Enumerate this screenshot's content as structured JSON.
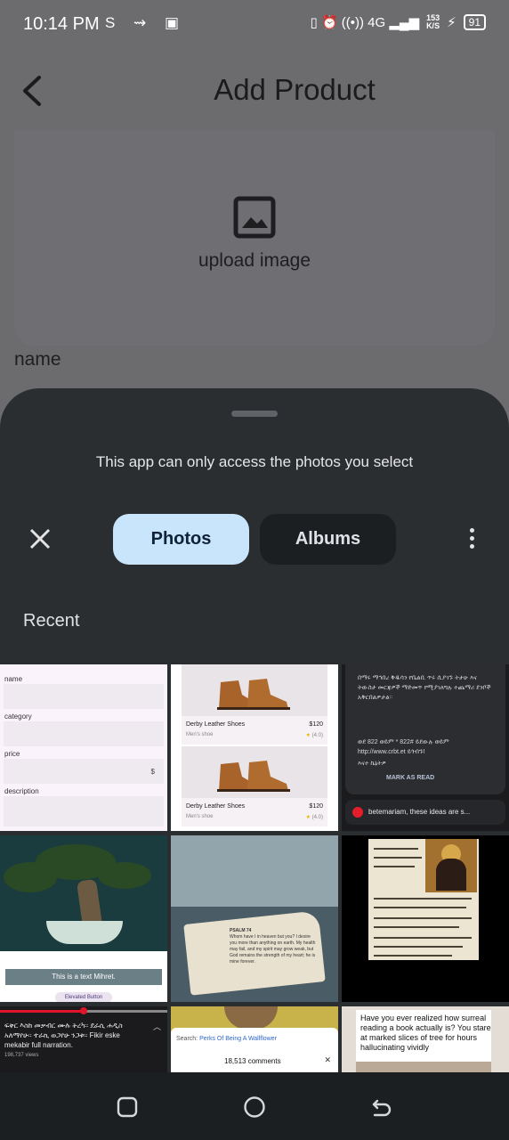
{
  "status_bar": {
    "time": "10:14 PM",
    "left_icons": "S ⇝ ▣",
    "right_icons": "▯ ⏰ ((•)) 4G ▂▄▆",
    "network_speed_top": "153",
    "network_speed_bottom": "K/S",
    "battery_level": "91"
  },
  "app": {
    "title": "Add Product",
    "upload_label": "upload image",
    "name_label": "name"
  },
  "picker": {
    "notice": "This app can only access the photos you select",
    "tabs": {
      "photos": "Photos",
      "albums": "Albums"
    },
    "section_title": "Recent",
    "tiles": {
      "form": {
        "labels": [
          "name",
          "category",
          "price",
          "description"
        ],
        "currency": "$"
      },
      "shoes": {
        "items": [
          {
            "name": "Derby Leather Shoes",
            "price": "$120",
            "subtitle": "Men's shoe",
            "rating": "(4.0)"
          },
          {
            "name": "Derby Leather Shoes",
            "price": "$120",
            "subtitle": "Men's shoe",
            "rating": "(4.0)"
          }
        ]
      },
      "message": {
        "lines": [
          "በማሩ ማኅበረ ቅዱሳን የቤልቢ ጥሩ ሲያገኙ ትታሁ እና ትውስታ መርጃዎች ማድመጥ የሚያገለግሉ ተጨማሪ ደንቦች አቅርበልዎታል።",
          "ወደ 822 ወይም * 822# ይደውሉ ወይም http://www.crbt.et ይጎብኙ!",
          "እናተ ኬኔትዎ"
        ],
        "action": "MARK AS READ",
        "pin_text": "betemariam, these ideas are s..."
      },
      "bonsai": {
        "caption": "This is a text Mihret.",
        "button": "Elevated Button"
      },
      "book": {
        "heading": "PSALM 74",
        "text": "Whom have I in heaven but you? I desire you more than anything on earth. My health may fail, and my spirit may grow weak, but God remains the strength of my heart; he is mine forever."
      },
      "video": {
        "title": "ፍቅር እስከ መቃብር ሙሉ ትረካ። ደራሲ ሐዲስ አለማየሁ። ተራኪ ወጋየሁ ንጋቱ። Fikir eske mekabir full narration.",
        "views": "198,737 views"
      },
      "search": {
        "prefix": "Search: ",
        "query": "Perks Of Being A Wallflower",
        "comments": "18,513 comments"
      },
      "post": {
        "text": "Have you ever realized how surreal reading a book actually is? You stare at marked slices of tree for hours hallucinating vividly"
      }
    }
  },
  "icons": {
    "back": "back-arrow-icon",
    "upload": "image-icon",
    "close": "close-icon",
    "more": "more-vert-icon",
    "nav_recent": "recents-icon",
    "nav_home": "home-icon",
    "nav_back": "back-icon"
  },
  "colors": {
    "sheet_bg": "#2b2e31",
    "photos_tab": "#c8e5fc",
    "albums_tab": "#1c1f22",
    "scrim_bg": "#6c6b6e"
  }
}
